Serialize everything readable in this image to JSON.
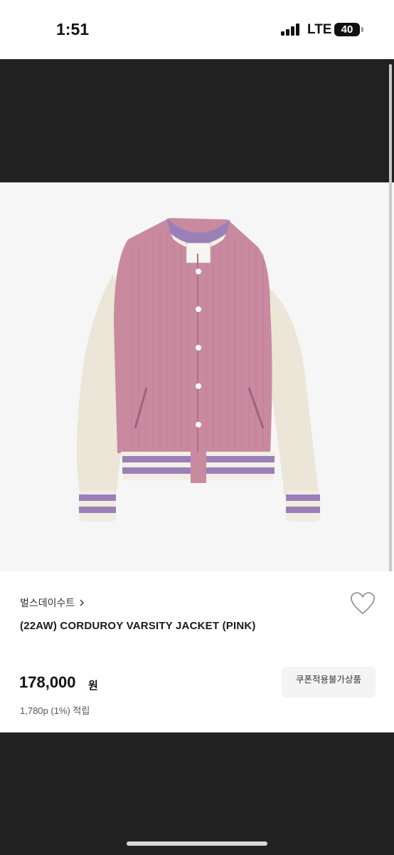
{
  "status_bar": {
    "time": "1:51",
    "network": "LTE",
    "battery": "40"
  },
  "product": {
    "brand": "벌스데이수트",
    "title": "(22AW) CORDUROY VARSITY JACKET (PINK)",
    "price": "178,000",
    "currency": "원",
    "points": "1,780p (1%) 적립",
    "coupon_notice": "쿠폰적용불가상품",
    "image_icon": "varsity-jacket-image"
  },
  "icons": {
    "wishlist": "heart-icon",
    "brand_chevron": "chevron-right-icon"
  },
  "colors": {
    "body_pink": "#c98aa0",
    "sleeve_cream": "#ebe6d8",
    "rib_lavender": "#9b80b8"
  }
}
